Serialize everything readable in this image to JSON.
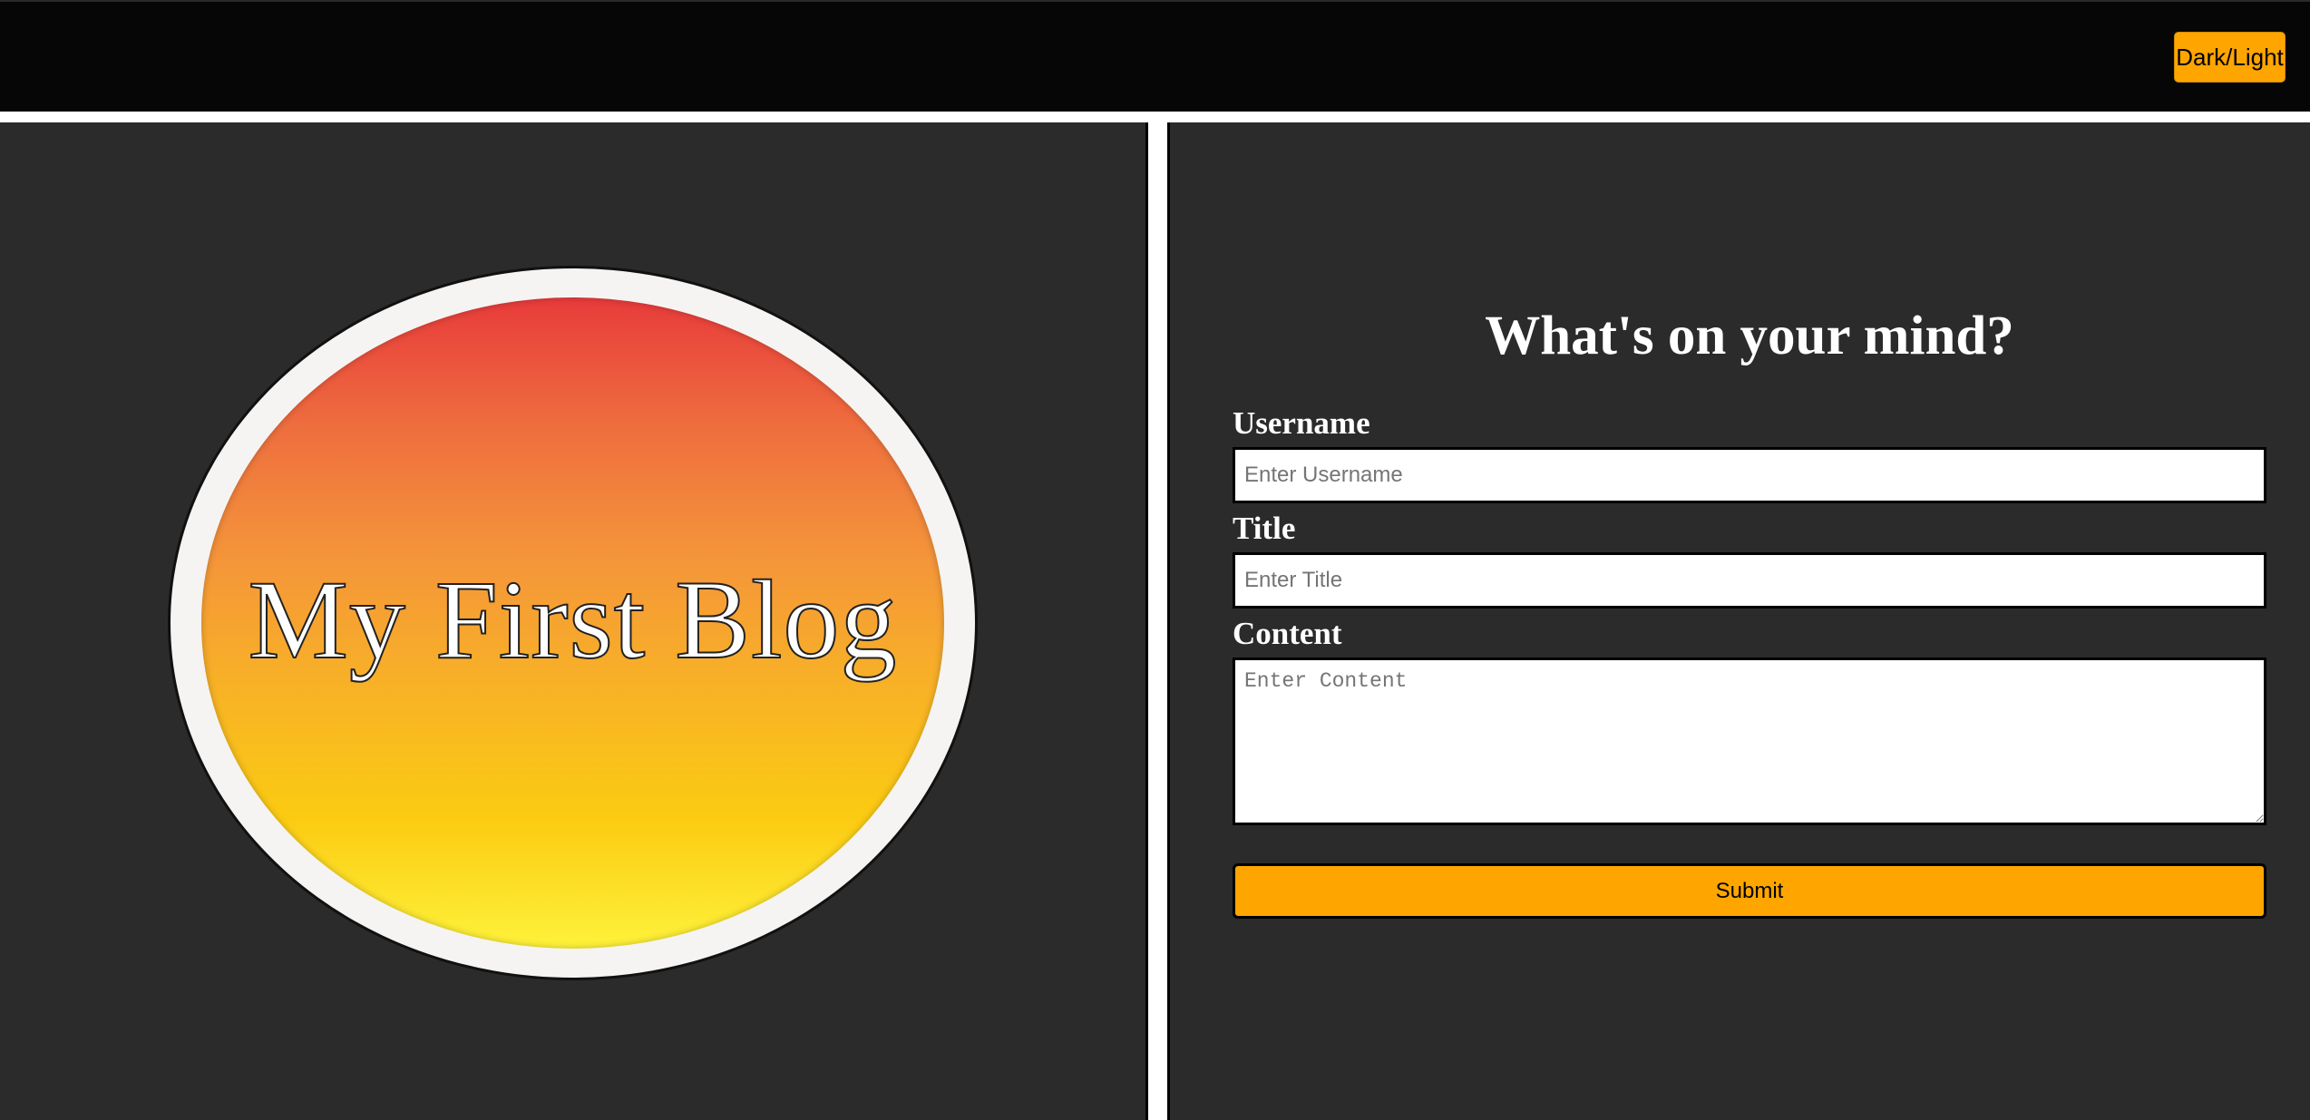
{
  "header": {
    "theme_toggle_label": "Dark/Light"
  },
  "logo": {
    "text": "My First Blog"
  },
  "form": {
    "title": "What's on your mind?",
    "username_label": "Username",
    "username_placeholder": "Enter Username",
    "title_label": "Title",
    "title_placeholder": "Enter Title",
    "content_label": "Content",
    "content_placeholder": "Enter Content",
    "submit_label": "Submit"
  },
  "colors": {
    "topbar": "#060606",
    "panel": "#2b2b2b",
    "accent": "#ffa500",
    "gradient_top": "#e83b3b",
    "gradient_bottom": "#fef23a"
  }
}
